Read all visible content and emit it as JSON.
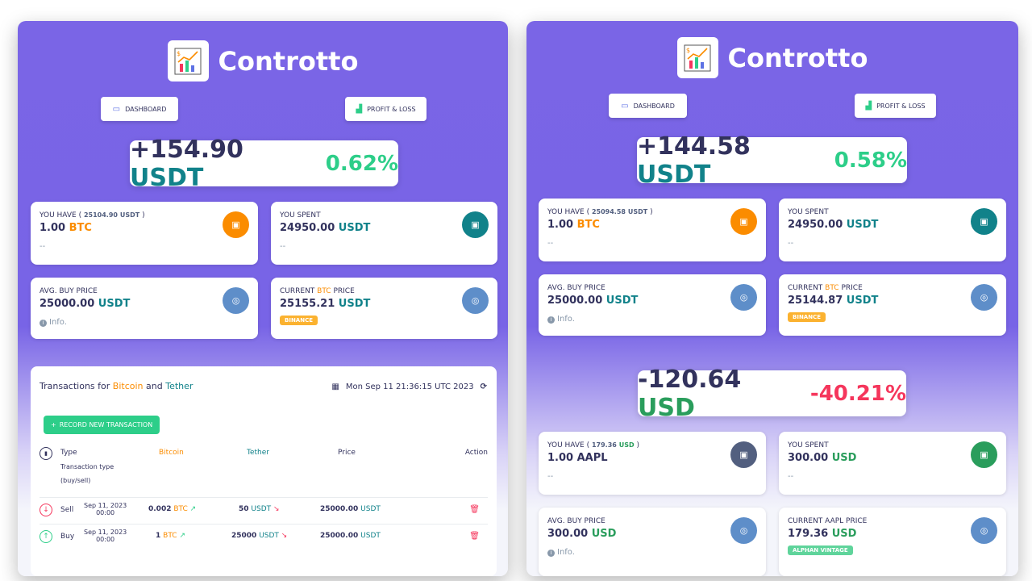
{
  "left": {
    "brand": "Controtto",
    "nav": {
      "dashboard": "DASHBOARD",
      "pnl": "PROFIT & LOSS"
    },
    "summary": {
      "amount": "+154.90",
      "currency": "USDT",
      "percent": "0.62%"
    },
    "cards": {
      "have": {
        "label": "YOU HAVE ( ",
        "sub_value": "25104.90",
        "sub_cur": "USDT",
        "sub_close": " )",
        "value": "1.00",
        "unit": "BTC",
        "note": "--"
      },
      "spent": {
        "label": "YOU SPENT",
        "value": "24950.00",
        "unit": "USDT",
        "note": "--"
      },
      "avg": {
        "label": "AVG. BUY PRICE",
        "value": "25000.00",
        "unit": "USDT",
        "note": "Info."
      },
      "current": {
        "label_pre": "CURRENT ",
        "label_asset": "BTC",
        "label_post": " PRICE",
        "value": "25155.21",
        "unit": "USDT",
        "badge": "BINANCE"
      }
    },
    "transactions": {
      "title_pre": "Transactions for ",
      "base": "Bitcoin",
      "and": " and ",
      "quote": "Tether",
      "date": "Mon Sep 11 21:36:15 UTC 2023",
      "record_button": "RECORD NEW TRANSACTION",
      "headers": {
        "type": "Type",
        "type_sub1": "Transaction type",
        "type_sub2": "(buy/sell)",
        "bitcoin": "Bitcoin",
        "tether": "Tether",
        "price": "Price",
        "action": "Action"
      },
      "rows": [
        {
          "kind": "Sell",
          "date": "Sep 11, 2023",
          "time": "00:00",
          "base_amt": "0.002",
          "base_cur": "BTC",
          "quote_amt": "50",
          "quote_cur": "USDT",
          "price": "25000.00",
          "price_cur": "USDT"
        },
        {
          "kind": "Buy",
          "date": "Sep 11, 2023",
          "time": "00:00",
          "base_amt": "1",
          "base_cur": "BTC",
          "quote_amt": "25000",
          "quote_cur": "USDT",
          "price": "25000.00",
          "price_cur": "USDT"
        }
      ]
    }
  },
  "right": {
    "brand": "Controtto",
    "nav": {
      "dashboard": "DASHBOARD",
      "pnl": "PROFIT & LOSS"
    },
    "summary": {
      "amount": "+144.58",
      "currency": "USDT",
      "percent": "0.58%"
    },
    "cards": {
      "have": {
        "label": "YOU HAVE ( ",
        "sub_value": "25094.58",
        "sub_cur": "USDT",
        "sub_close": " )",
        "value": "1.00",
        "unit": "BTC",
        "note": "--"
      },
      "spent": {
        "label": "YOU SPENT",
        "value": "24950.00",
        "unit": "USDT",
        "note": "--"
      },
      "avg": {
        "label": "AVG. BUY PRICE",
        "value": "25000.00",
        "unit": "USDT",
        "note": "Info."
      },
      "current": {
        "label_pre": "CURRENT ",
        "label_asset": "BTC",
        "label_post": " PRICE",
        "value": "25144.87",
        "unit": "USDT",
        "badge": "BINANCE"
      }
    },
    "summary2": {
      "amount": "-120.64",
      "currency": "USD",
      "percent": "-40.21%"
    },
    "cards2": {
      "have": {
        "label": "YOU HAVE ( ",
        "sub_value": "179.36",
        "sub_cur": "USD",
        "sub_close": " )",
        "value": "1.00",
        "unit": "AAPL",
        "note": "--"
      },
      "spent": {
        "label": "YOU SPENT",
        "value": "300.00",
        "unit": "USD",
        "note": "--"
      },
      "avg": {
        "label": "AVG. BUY PRICE",
        "value": "300.00",
        "unit": "USD",
        "note": "Info."
      },
      "current": {
        "label_pre": "CURRENT ",
        "label_asset": "AAPL",
        "label_post": " PRICE",
        "value": "179.36",
        "unit": "USD",
        "badge": "ALPHAN VINTAGE"
      }
    }
  }
}
